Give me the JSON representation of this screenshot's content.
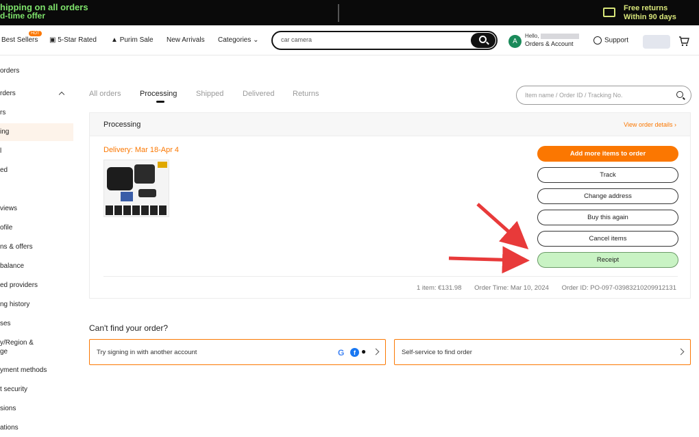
{
  "promo": {
    "line1": "hipping on all orders",
    "line2": "d-time offer"
  },
  "returns": {
    "line1": "Free returns",
    "line2": "Within 90 days"
  },
  "nav": {
    "best_sellers": "Best Sellers",
    "hot_badge": "HOT",
    "five_star": "5-Star Rated",
    "purim_sale": "Purim Sale",
    "new_arrivals": "New Arrivals",
    "categories": "Categories",
    "search_value": "car camera",
    "hello": "Hello,",
    "avatar_letter": "A",
    "orders_account": "Orders & Account",
    "support": "Support"
  },
  "sidebar": {
    "items": [
      "orders",
      "rders",
      "rs",
      "ing",
      "l",
      "ed",
      "views",
      "ofile",
      "ns & offers",
      "balance",
      "ed providers",
      "ng history",
      "ses",
      "y/Region &",
      "ge",
      "yment methods",
      "t security",
      "sions",
      "ations"
    ]
  },
  "tabs": [
    "All orders",
    "Processing",
    "Shipped",
    "Delivered",
    "Returns"
  ],
  "order_search_placeholder": "Item name / Order ID / Tracking No.",
  "order": {
    "status_title": "Processing",
    "view_details": "View order details",
    "delivery": "Delivery: Mar 18-Apr 4",
    "buttons": {
      "add_more": "Add more items to order",
      "track": "Track",
      "change_address": "Change address",
      "buy_again": "Buy this again",
      "cancel": "Cancel items",
      "receipt": "Receipt"
    },
    "footer": {
      "items": "1 item: €131.98",
      "order_time": "Order Time: Mar 10, 2024",
      "order_id": "Order ID: PO-097-03983210209912131"
    }
  },
  "help": {
    "title": "Can't find your order?",
    "option1": "Try signing in with another account",
    "option2": "Self-service to find order"
  },
  "colors": {
    "accent": "#fb7701",
    "receipt_bg": "#c9f3c4",
    "arrow": "#e83a3a"
  }
}
